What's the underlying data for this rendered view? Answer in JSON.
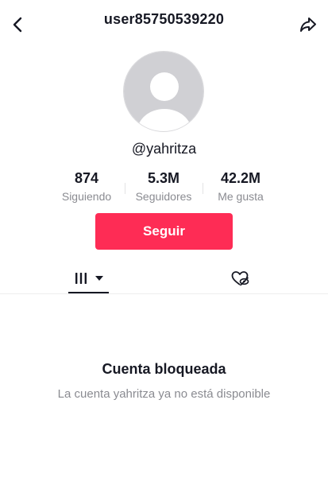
{
  "header": {
    "title": "user85750539220",
    "back_icon": "chevron-left-icon",
    "share_icon": "share-arrow-icon"
  },
  "profile": {
    "handle": "@yahritza",
    "avatar_icon": "default-avatar-icon"
  },
  "stats": {
    "following": {
      "value": "874",
      "label": "Siguiendo"
    },
    "followers": {
      "value": "5.3M",
      "label": "Seguidores"
    },
    "likes": {
      "value": "42.2M",
      "label": "Me gusta"
    }
  },
  "actions": {
    "follow_label": "Seguir"
  },
  "tabs": {
    "videos_icon": "video-grid-icon",
    "videos_dropdown_icon": "caret-down-icon",
    "liked_icon": "hidden-liked-icon"
  },
  "blocked": {
    "title": "Cuenta bloqueada",
    "description": "La cuenta yahritza ya no está disponible"
  },
  "colors": {
    "accent": "#fe2c55",
    "text_primary": "#161823",
    "text_secondary": "#8a8b91",
    "avatar_bg": "#d0d0d4",
    "avatar_fg": "#ffffff"
  }
}
